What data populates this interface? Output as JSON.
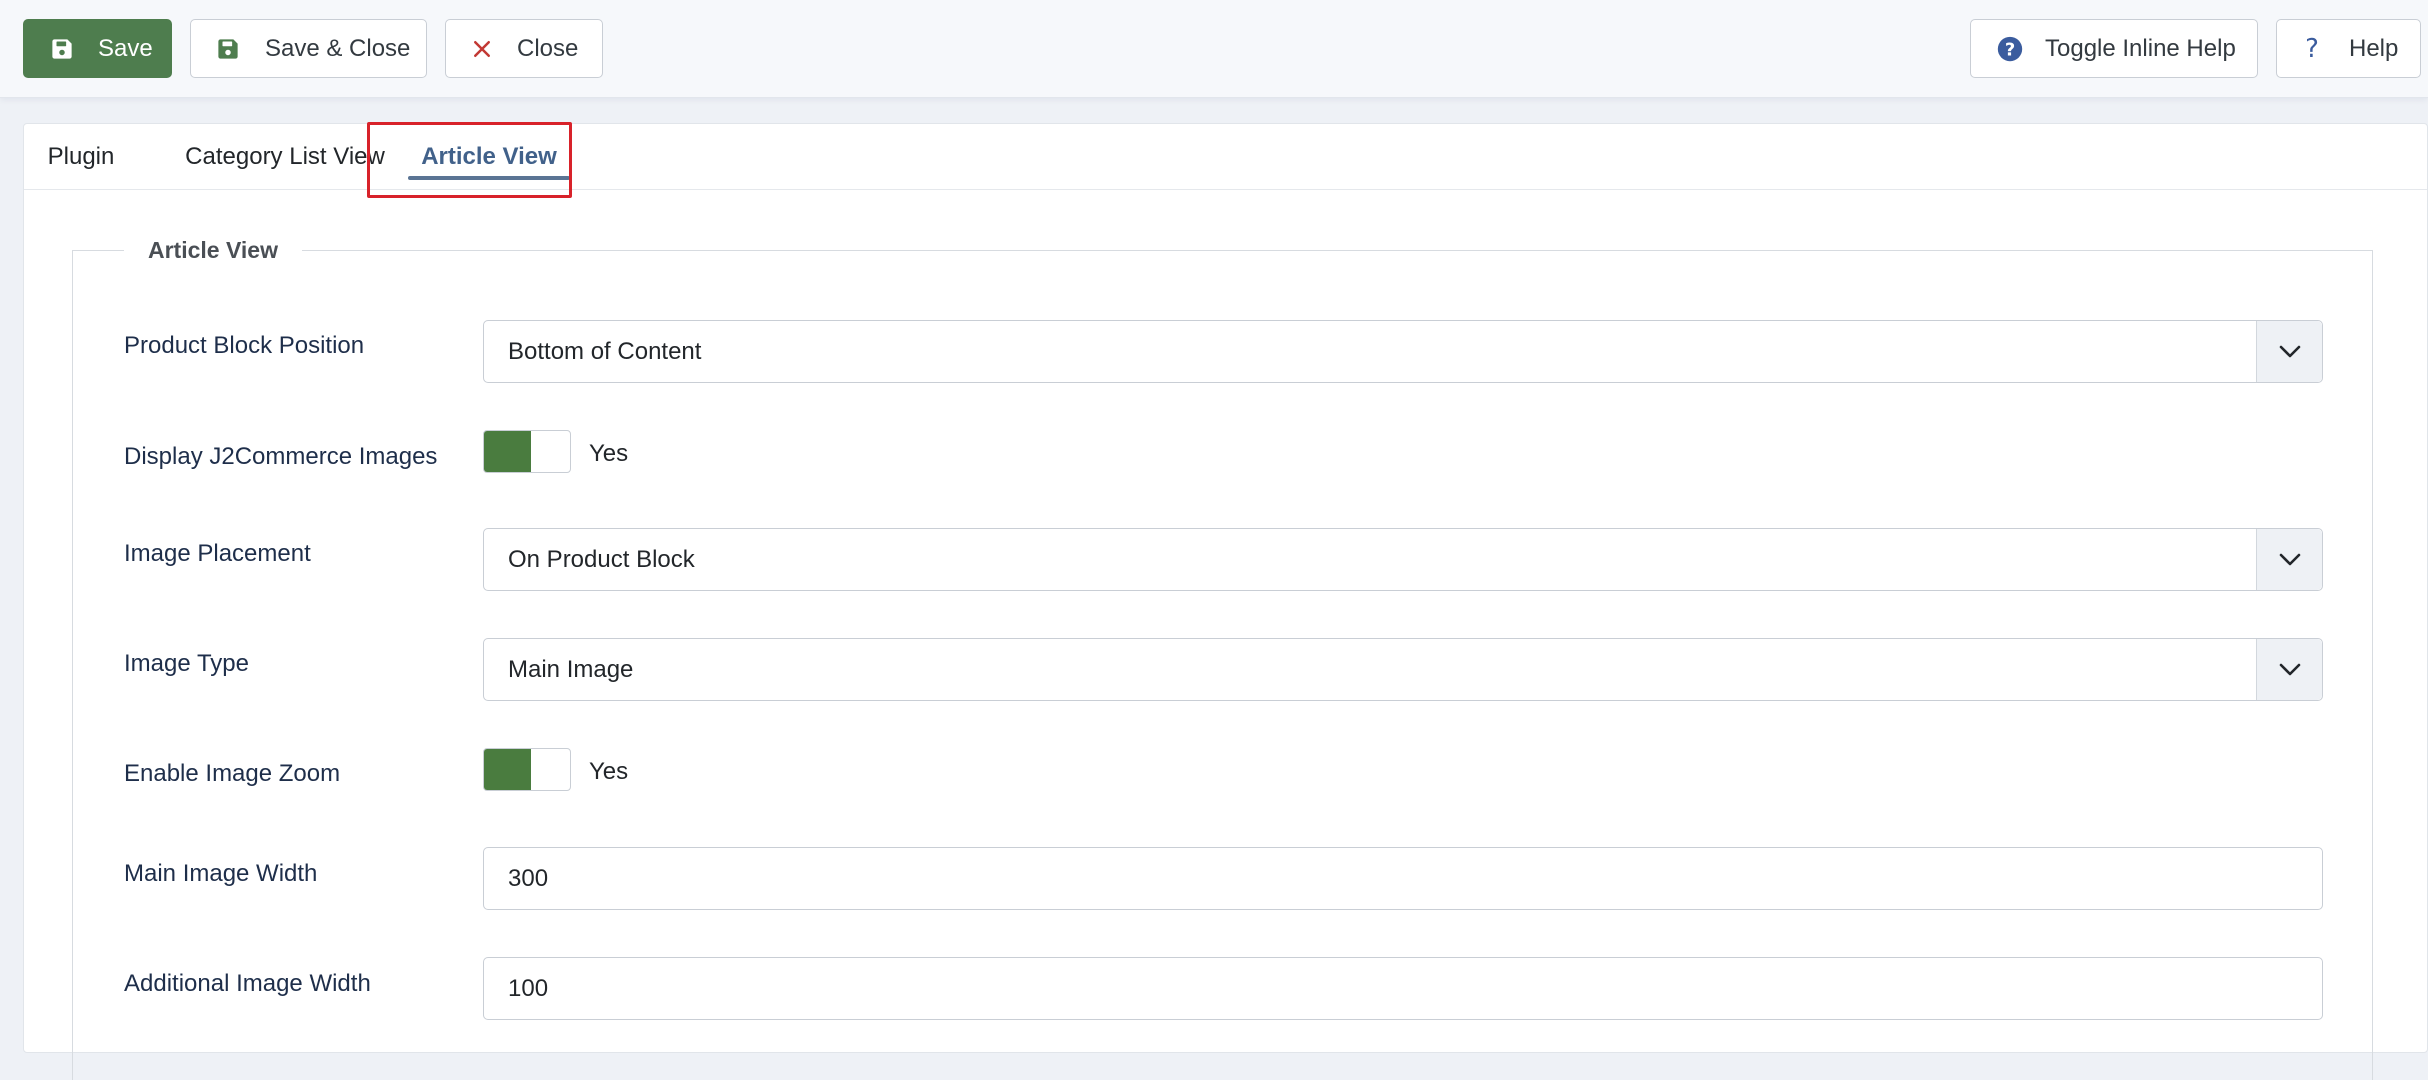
{
  "toolbar": {
    "save_label": "Save",
    "save_close_label": "Save & Close",
    "close_label": "Close",
    "toggle_inline_help_label": "Toggle Inline Help",
    "help_label": "Help"
  },
  "tabs": [
    {
      "label": "Plugin"
    },
    {
      "label": "Category List View"
    },
    {
      "label": "Article View",
      "active": true
    }
  ],
  "fieldset": {
    "legend": "Article View",
    "fields": {
      "product_block_position": {
        "label": "Product Block Position",
        "value": "Bottom of Content"
      },
      "display_images": {
        "label": "Display J2Commerce Images",
        "value": "Yes"
      },
      "image_placement": {
        "label": "Image Placement",
        "value": "On Product Block"
      },
      "image_type": {
        "label": "Image Type",
        "value": "Main Image"
      },
      "enable_zoom": {
        "label": "Enable Image Zoom",
        "value": "Yes"
      },
      "main_image_width": {
        "label": "Main Image Width",
        "value": "300"
      },
      "additional_image_width": {
        "label": "Additional Image Width",
        "value": "100"
      }
    }
  },
  "colors": {
    "save_button": "#4e7d4e",
    "switch_on": "#4a7c3f",
    "active_tab": "#41618a",
    "highlight": "#d8222a"
  }
}
